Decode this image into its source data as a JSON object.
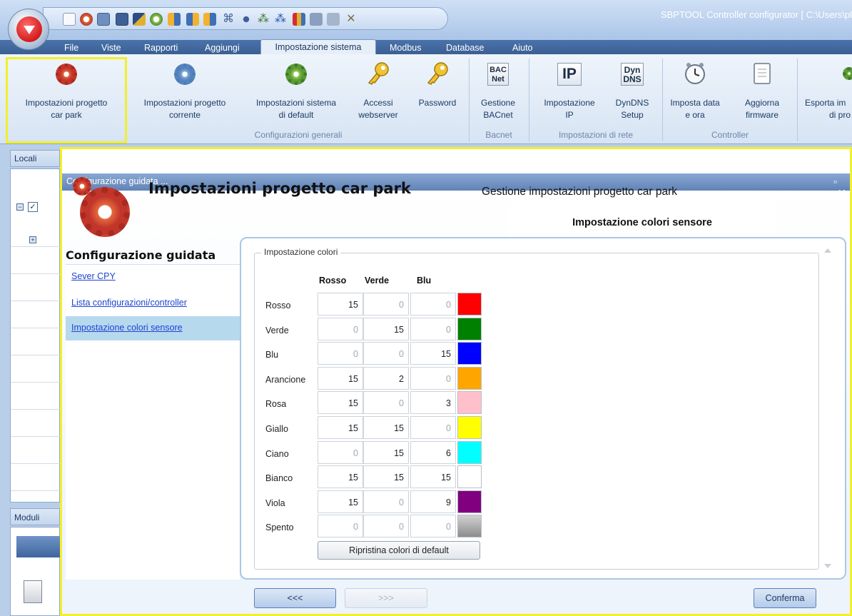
{
  "app": {
    "title": "SBPTOOL Controller configurator [ C:\\Users\\pl"
  },
  "menu": {
    "tabs": [
      "File",
      "Viste",
      "Rapporti",
      "Aggiungi",
      "Impostazione sistema",
      "Modbus",
      "Database",
      "Aiuto"
    ],
    "selected": "Impostazione sistema"
  },
  "ribbon": {
    "items": [
      {
        "label1": "Impostazioni progetto",
        "label2": "car park",
        "icon": "gear-icon"
      },
      {
        "label1": "Impostazioni progetto",
        "label2": "corrente",
        "icon": "gear-icon"
      },
      {
        "label1": "Impostazioni sistema",
        "label2": "di default",
        "icon": "gear-icon"
      },
      {
        "label1": "Accessi",
        "label2": "webserver",
        "icon": "key-icon"
      },
      {
        "label1": "Password",
        "label2": "",
        "icon": "key-icon"
      },
      {
        "label1": "Gestione",
        "label2": "BACnet",
        "icon": "bacnet-icon",
        "icon_text": "BAC Net"
      },
      {
        "label1": "Impostazione",
        "label2": "IP",
        "icon": "ip-icon",
        "icon_text": "IP"
      },
      {
        "label1": "DynDNS",
        "label2": "Setup",
        "icon": "dyndns-icon",
        "icon_text": "Dyn DNS"
      },
      {
        "label1": "Imposta data",
        "label2": "e ora",
        "icon": "clock-icon"
      },
      {
        "label1": "Aggiorna",
        "label2": "firmware",
        "icon": "document-icon"
      },
      {
        "label1": "Esporta im",
        "label2": "di pro",
        "icon": "export-icon"
      }
    ],
    "groups": [
      "Configurazioni generali",
      "Bacnet",
      "Impostazioni di rete",
      "Controller"
    ]
  },
  "panels": {
    "locali": "Locali",
    "moduli": "Moduli"
  },
  "dialog": {
    "caption": "Configurazione guidata ...",
    "title": "Impostazioni progetto car park",
    "subtitle": "Gestione impostazioni progetto car park",
    "step_title": "Impostazione colori sensore",
    "sidebar_title": "Configurazione guidata",
    "sidebar_items": [
      "Sever CPY",
      "Lista configurazioni/controller",
      "Impostazione colori sensore"
    ],
    "selected_item": "Impostazione colori sensore",
    "fieldset_legend": "Impostazione colori",
    "columns": [
      "Rosso",
      "Verde",
      "Blu"
    ],
    "rows": [
      {
        "name": "Rosso",
        "r": "15",
        "g": "0",
        "b": "0",
        "color": "#ff0000"
      },
      {
        "name": "Verde",
        "r": "0",
        "g": "15",
        "b": "0",
        "color": "#008000"
      },
      {
        "name": "Blu",
        "r": "0",
        "g": "0",
        "b": "15",
        "color": "#0000ff"
      },
      {
        "name": "Arancione",
        "r": "15",
        "g": "2",
        "b": "0",
        "color": "#ffa500"
      },
      {
        "name": "Rosa",
        "r": "15",
        "g": "0",
        "b": "3",
        "color": "#ffc0cb"
      },
      {
        "name": "Giallo",
        "r": "15",
        "g": "15",
        "b": "0",
        "color": "#ffff00"
      },
      {
        "name": "Ciano",
        "r": "0",
        "g": "15",
        "b": "6",
        "color": "#00ffff"
      },
      {
        "name": "Bianco",
        "r": "15",
        "g": "15",
        "b": "15",
        "color": "#ffffff"
      },
      {
        "name": "Viola",
        "r": "15",
        "g": "0",
        "b": "9",
        "color": "#800080"
      },
      {
        "name": "Spento",
        "r": "0",
        "g": "0",
        "b": "0",
        "color": "#a6a6a6"
      }
    ],
    "reset_label": "Ripristina colori di default",
    "prev_label": "<<<",
    "next_label": ">>>",
    "confirm_label": "Conferma"
  }
}
